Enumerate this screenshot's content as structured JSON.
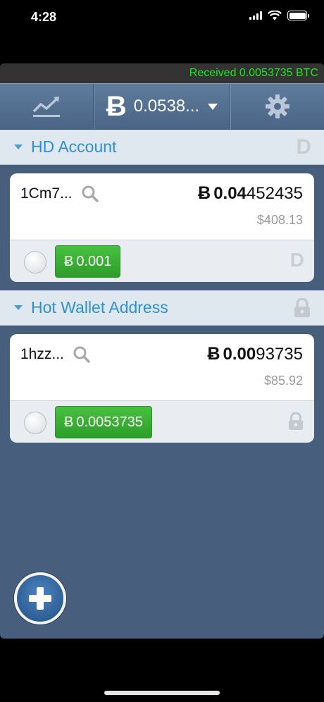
{
  "status": {
    "time": "4:28"
  },
  "notice": {
    "text": "Received 0.0053735 BTC"
  },
  "toolbar": {
    "currency_symbol": "Ƀ",
    "balance": "0.0538..."
  },
  "accounts": [
    {
      "title": "HD Account",
      "badge": "D",
      "address": "1Cm7...",
      "btc_symbol": "Ƀ",
      "btc_main": "0.04",
      "btc_rest": "452435",
      "fiat": "$408.13",
      "send_symbol": "Ƀ",
      "send_amount": "0.001",
      "bottom_badge": "D"
    },
    {
      "title": "Hot Wallet Address",
      "address": "1hzz...",
      "btc_symbol": "Ƀ",
      "btc_main": "0.00",
      "btc_rest": "93735",
      "fiat": "$85.92",
      "send_symbol": "Ƀ",
      "send_amount": "0.0053735"
    }
  ],
  "colors": {
    "notice_text": "#1ee61e",
    "section_title": "#2f8fcf",
    "send_button": "#3aa535",
    "background": "#485e7d"
  },
  "icons": [
    "trend-chart-icon",
    "bitcoin-icon",
    "gear-icon",
    "search-icon",
    "lock-icon",
    "plus-icon",
    "wifi-icon",
    "battery-icon",
    "signal-icon"
  ]
}
